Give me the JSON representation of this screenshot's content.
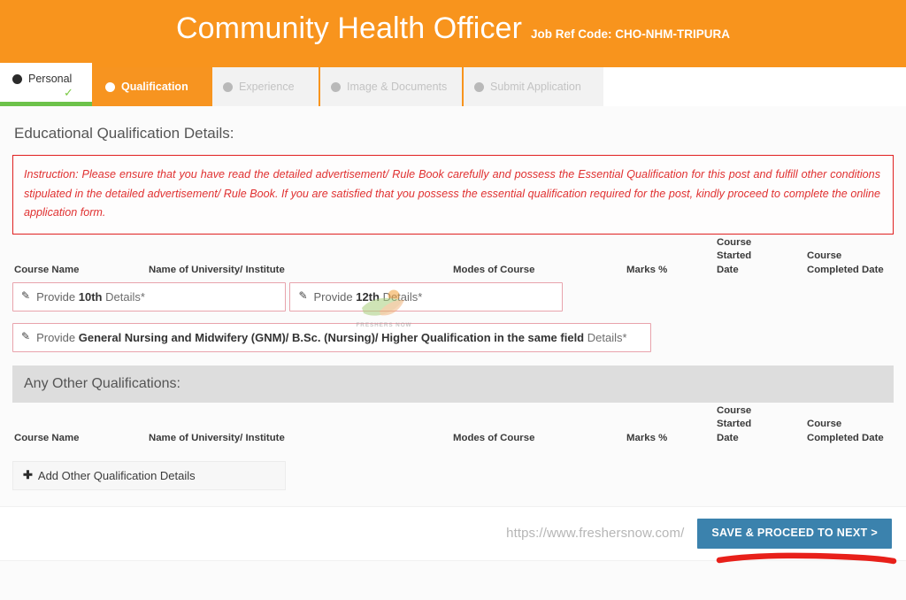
{
  "header": {
    "title": "Community Health Officer",
    "job_ref_label": "Job Ref Code: CHO-NHM-TRIPURA",
    "background_color": "#f8941d"
  },
  "tabs": [
    {
      "label": "Personal",
      "state": "completed",
      "icon": "filled-circle-icon",
      "check": "✓"
    },
    {
      "label": "Qualification",
      "state": "active",
      "icon": "filled-circle-icon"
    },
    {
      "label": "Experience",
      "state": "disabled",
      "icon": "filled-circle-icon"
    },
    {
      "label": "Image & Documents",
      "state": "disabled",
      "icon": "filled-circle-icon"
    },
    {
      "label": "Submit Application",
      "state": "disabled",
      "icon": "filled-circle-icon"
    }
  ],
  "main": {
    "section_title": "Educational Qualification Details:",
    "instruction": "Instruction: Please ensure that you have read the detailed advertisement/ Rule Book carefully and possess the Essential Qualification for this post and fulfill other conditions stipulated in the detailed advertisement/ Rule Book. If you are satisfied that you possess the essential qualification required for the post, kindly proceed to complete the online application form.",
    "instruction_color": "#e03131",
    "columns": {
      "course_name": "Course Name",
      "university": "Name of University/ Institute",
      "modes": "Modes of Course",
      "marks": "Marks %",
      "started_line1": "Course Started",
      "started_line2": "Date",
      "completed_line1": "Course",
      "completed_line2": "Completed Date"
    },
    "qualification_rows": [
      {
        "prefix": "Provide ",
        "bold": "10th",
        "suffix": " Details*",
        "icon": "pencil-icon"
      },
      {
        "prefix": "Provide ",
        "bold": "12th",
        "suffix": " Details*",
        "icon": "pencil-icon"
      },
      {
        "prefix": "Provide ",
        "bold": "General Nursing and Midwifery (GNM)/ B.Sc. (Nursing)/ Higher Qualification in the same field",
        "suffix": " Details*",
        "icon": "pencil-icon"
      }
    ],
    "other_section": {
      "title": "Any Other Qualifications:",
      "add_button_label": "Add Other Qualification Details",
      "add_button_icon": "plus-icon"
    },
    "watermark": {
      "text": "FRESHERS NOW"
    }
  },
  "footer": {
    "site_url": "https://www.freshersnow.com/",
    "save_button_label": "SAVE & PROCEED TO NEXT >",
    "save_button_color": "#3b82ad",
    "highlight_color": "#e8201a"
  }
}
